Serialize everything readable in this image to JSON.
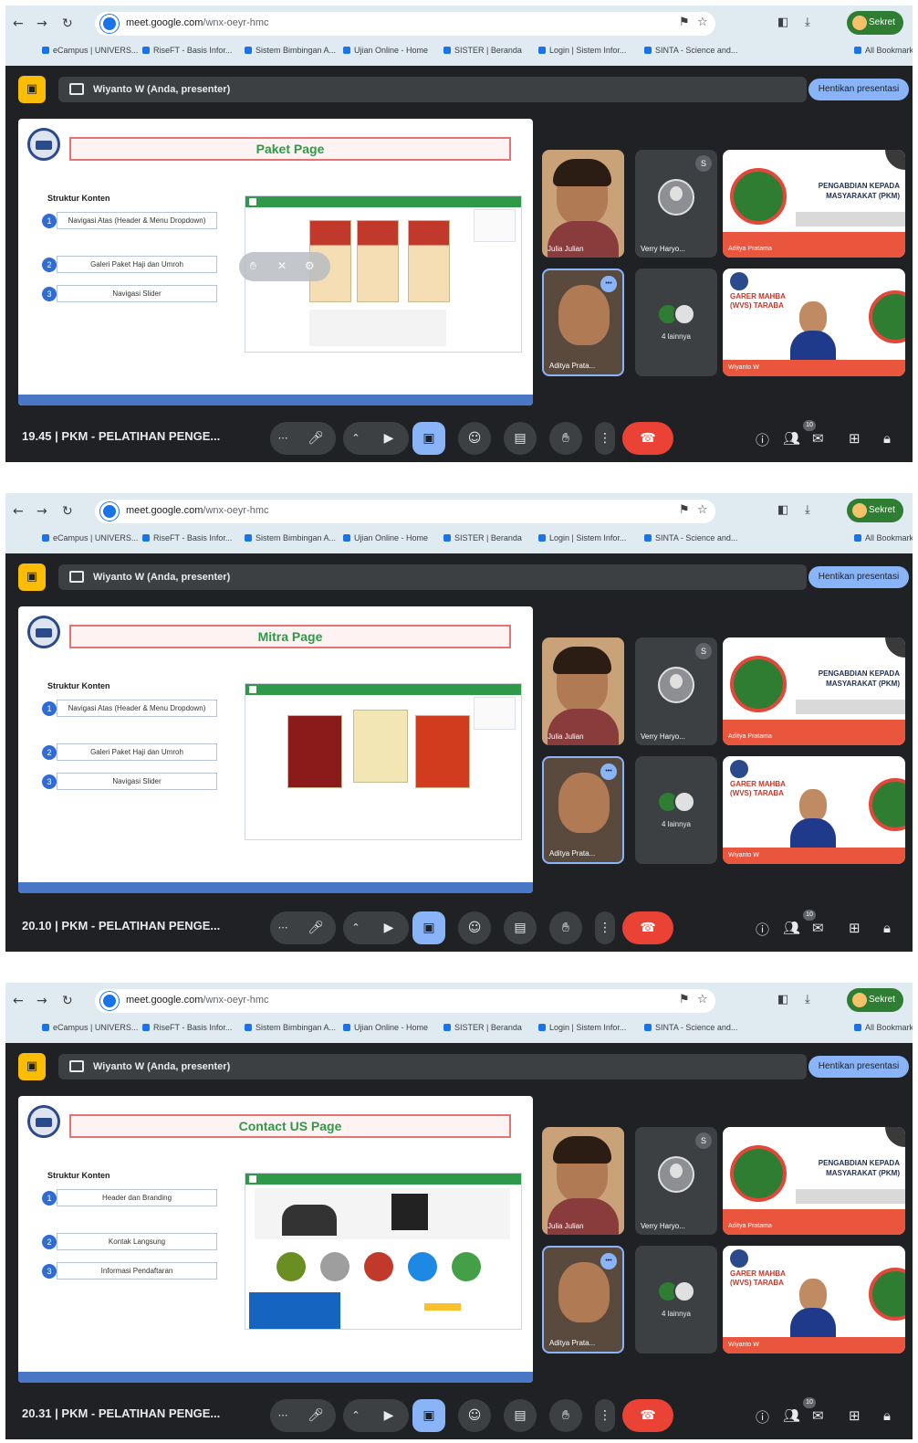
{
  "browser": {
    "url_host": "meet.google.com",
    "url_path": "/wnx-oeyr-hmc",
    "profile_label": "Sekret",
    "bookmarks": [
      "eCampus | UNIVERS...",
      "RiseFT - Basis Infor...",
      "Sistem Bimbingan A...",
      "Ujian Online - Home",
      "SISTER | Beranda",
      "Login | Sistem Infor...",
      "SINTA - Science and...",
      "All Bookmarks"
    ]
  },
  "meeting": {
    "presenter_label": "Wiyanto W (Anda, presenter)",
    "stop_button": "Hentikan presentasi",
    "title": "PKM - PELATIHAN PENGE...",
    "participant_count": "10",
    "participants": {
      "p1": "Julia Julian",
      "p2": "Verry Haryo...",
      "p3": "Aditya Prata...",
      "others": "4 lainnya",
      "p5": "Aditya Pratama",
      "p6": "Wiyanto W",
      "more_badge": "•••",
      "mini_badge": "S"
    },
    "poster_text_1": "PENGABDIAN KEPADA",
    "poster_text_2": "MASYARAKAT (PKM)",
    "poster_text_3": "GARER MAHBA",
    "poster_text_4": "(WVS) TARABA"
  },
  "screens": [
    {
      "time": "19.45",
      "slide_title": "Paket Page",
      "structure_label": "Struktur Konten",
      "items": [
        {
          "num": "1",
          "label": "Navigasi Atas (Header & Menu Dropdown)"
        },
        {
          "num": "2",
          "label": "Galeri Paket Haji dan Umroh"
        },
        {
          "num": "3",
          "label": "Navigasi Slider"
        }
      ]
    },
    {
      "time": "20.10",
      "slide_title": "Mitra Page",
      "structure_label": "Struktur Konten",
      "items": [
        {
          "num": "1",
          "label": "Navigasi Atas (Header & Menu Dropdown)"
        },
        {
          "num": "2",
          "label": "Galeri Paket Haji dan Umroh"
        },
        {
          "num": "3",
          "label": "Navigasi Slider"
        }
      ]
    },
    {
      "time": "20.31",
      "slide_title": "Contact US Page",
      "structure_label": "Struktur Konten",
      "items": [
        {
          "num": "1",
          "label": "Header dan Branding"
        },
        {
          "num": "2",
          "label": "Kontak Langsung"
        },
        {
          "num": "3",
          "label": "Informasi Pendaftaran"
        }
      ]
    }
  ],
  "colors": {
    "meet_bg": "#202124",
    "end_call": "#ea4335",
    "active_present": "#8ab4f8",
    "slide_title_green": "#2e9a49",
    "slide_border_red": "#e57373"
  }
}
